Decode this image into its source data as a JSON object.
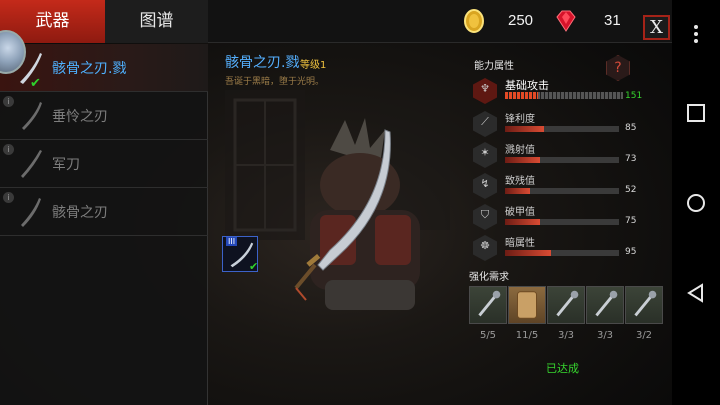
{
  "tabs": [
    {
      "label": "武器",
      "active": true
    },
    {
      "label": "图谱",
      "active": false
    }
  ],
  "resources": {
    "gold": {
      "icon": "gold-coin-icon",
      "value": "250"
    },
    "gems": {
      "icon": "red-gem-icon",
      "value": "31"
    }
  },
  "close_label": "X",
  "weapon_list": [
    {
      "name": "骸骨之刃.戮",
      "selected": true
    },
    {
      "name": "垂怜之刃",
      "selected": false
    },
    {
      "name": "军刀",
      "selected": false
    },
    {
      "name": "骸骨之刃",
      "selected": false
    }
  ],
  "detail": {
    "title": "骸骨之刃.戮",
    "level": "等级1",
    "description": "吾诞于黑暗，堕于光明。",
    "mini_tier": "III"
  },
  "attributes": {
    "title": "能力属性",
    "help": "?",
    "base": {
      "name": "基础攻击",
      "value": "151",
      "fill": 0.28
    },
    "items": [
      {
        "name": "锋利度",
        "value": "85",
        "fill": 0.34,
        "icon": "blade-sharpness-icon"
      },
      {
        "name": "溅射值",
        "value": "73",
        "fill": 0.31,
        "icon": "splash-icon"
      },
      {
        "name": "致残值",
        "value": "52",
        "fill": 0.22,
        "icon": "cripple-icon"
      },
      {
        "name": "破甲值",
        "value": "75",
        "fill": 0.31,
        "icon": "armor-break-icon"
      },
      {
        "name": "暗属性",
        "value": "95",
        "fill": 0.4,
        "icon": "dark-element-icon"
      }
    ]
  },
  "requirements": {
    "title": "强化需求",
    "items": [
      {
        "count": "5/5",
        "icon": "mace-material-icon"
      },
      {
        "count": "11/5",
        "icon": "wood-material-icon"
      },
      {
        "count": "3/3",
        "icon": "bone-material-icon"
      },
      {
        "count": "3/3",
        "icon": "horn-material-icon"
      },
      {
        "count": "3/2",
        "icon": "claw-material-icon"
      }
    ],
    "status": "已达成"
  },
  "colors": {
    "accent_red": "#c42a1a",
    "selected_blue": "#4fb1ff",
    "achieved_green": "#36d52e",
    "level_gold": "#f0c23e"
  }
}
